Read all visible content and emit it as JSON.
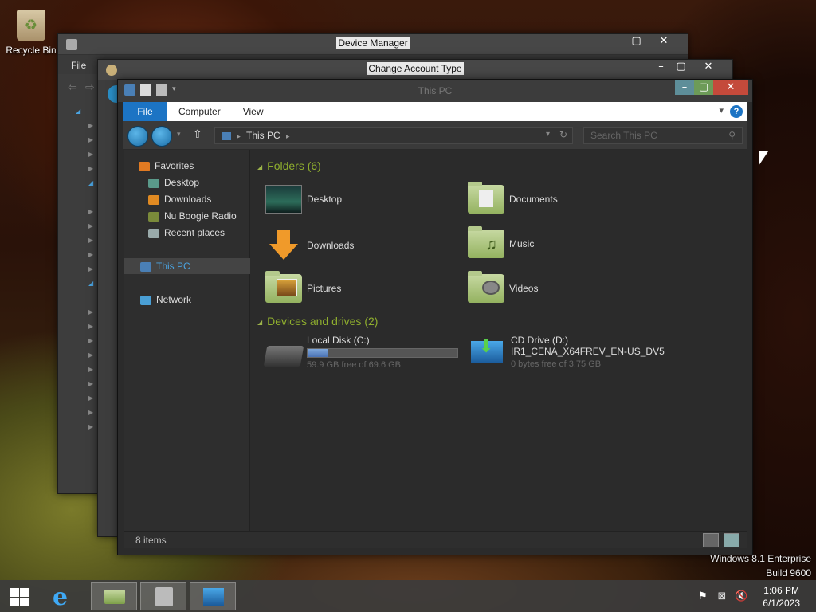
{
  "desktop": {
    "recycle_bin_label": "Recycle Bin",
    "watermark": [
      "Windows 8.1 Enterprise",
      "Build 9600"
    ]
  },
  "device_manager": {
    "title": "Device Manager",
    "menu_file": "File"
  },
  "change_account": {
    "title": "Change Account Type"
  },
  "explorer": {
    "title": "This PC",
    "ribbon_tabs": [
      "File",
      "Computer",
      "View"
    ],
    "help_label": "?",
    "address_path": "This PC",
    "search_placeholder": "Search This PC",
    "nav": {
      "favorites": "Favorites",
      "items": [
        "Desktop",
        "Downloads",
        "Nu Boogie Radio",
        "Recent places"
      ],
      "this_pc": "This PC",
      "network": "Network"
    },
    "folders_header": "Folders (6)",
    "folders": [
      "Desktop",
      "Documents",
      "Downloads",
      "Music",
      "Pictures",
      "Videos"
    ],
    "devices_header": "Devices and drives (2)",
    "drives": [
      {
        "name": "Local Disk (C:)",
        "free": "59.9 GB free of 69.6 GB",
        "used_fraction": 0.14
      },
      {
        "name": "CD Drive (D:)",
        "label": "IR1_CENA_X64FREV_EN-US_DV5",
        "free": "0 bytes free of 3.75 GB"
      }
    ],
    "status": "8 items"
  },
  "taskbar": {
    "time": "1:06 PM",
    "date": "6/1/2023"
  },
  "colors": {
    "accent": "#1c74c4",
    "group_header": "#8fae2e",
    "close": "#c44a3b"
  }
}
